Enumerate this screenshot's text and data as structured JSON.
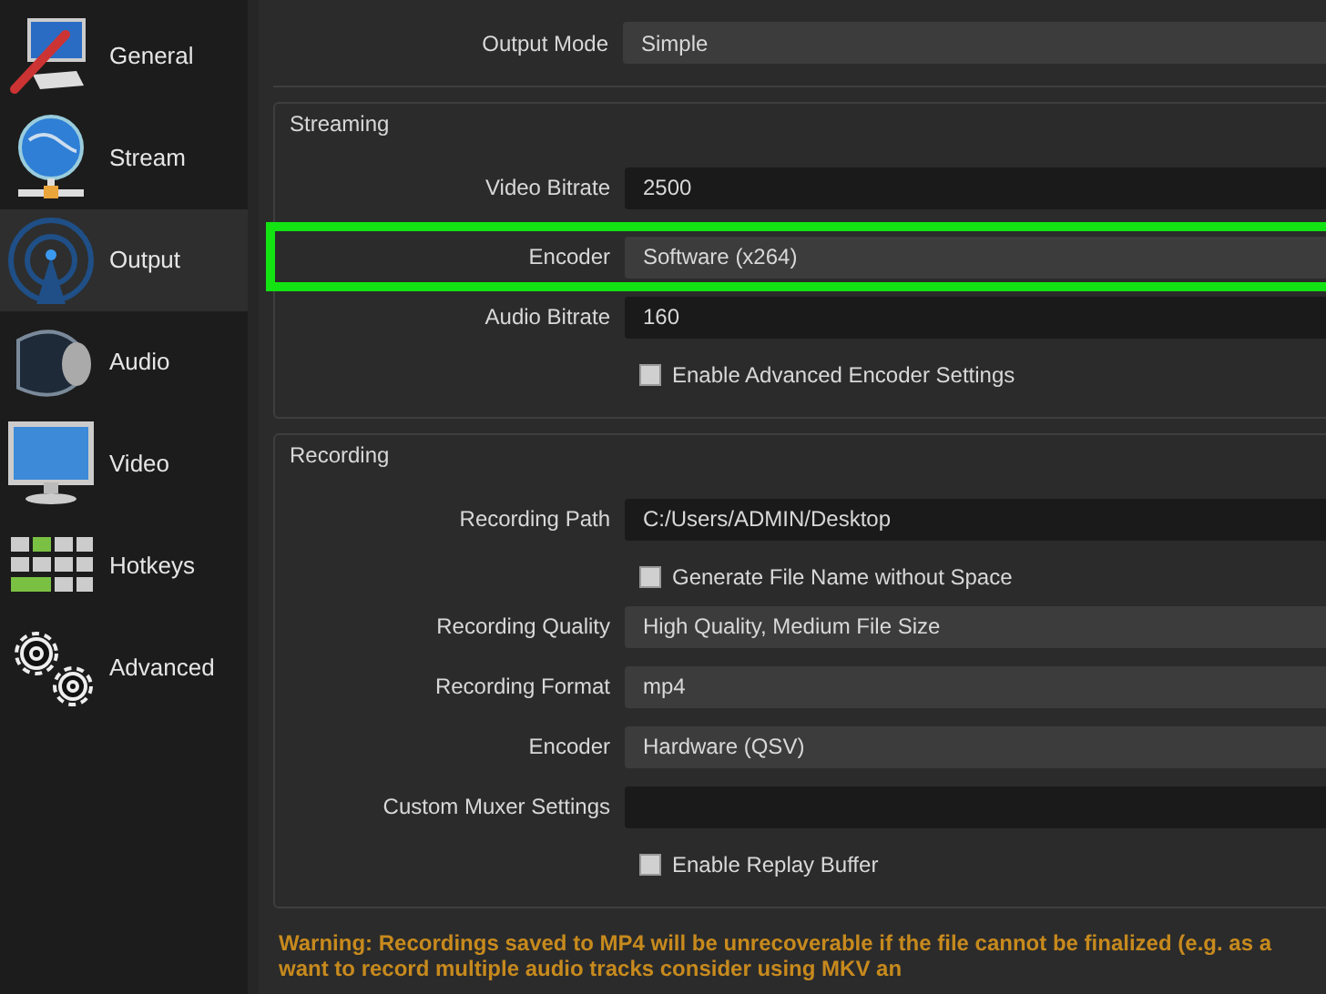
{
  "sidebar": {
    "items": [
      {
        "label": "General",
        "selected": false
      },
      {
        "label": "Stream",
        "selected": false
      },
      {
        "label": "Output",
        "selected": true
      },
      {
        "label": "Audio",
        "selected": false
      },
      {
        "label": "Video",
        "selected": false
      },
      {
        "label": "Hotkeys",
        "selected": false
      },
      {
        "label": "Advanced",
        "selected": false
      }
    ]
  },
  "output_mode": {
    "label": "Output Mode",
    "value": "Simple"
  },
  "groups": [
    {
      "title": "Streaming",
      "rows": [
        {
          "kind": "input",
          "label": "Video Bitrate",
          "value": "2500",
          "highlighted": false
        },
        {
          "kind": "select",
          "label": "Encoder",
          "value": "Software (x264)",
          "highlighted": true
        },
        {
          "kind": "input",
          "label": "Audio Bitrate",
          "value": "160",
          "highlighted": false
        },
        {
          "kind": "checkbox",
          "label": "Enable Advanced Encoder Settings",
          "checked": false
        }
      ]
    },
    {
      "title": "Recording",
      "rows": [
        {
          "kind": "input",
          "label": "Recording Path",
          "value": "C:/Users/ADMIN/Desktop",
          "highlighted": false
        },
        {
          "kind": "checkbox",
          "label": "Generate File Name without Space",
          "checked": false
        },
        {
          "kind": "select",
          "label": "Recording Quality",
          "value": "High Quality, Medium File Size",
          "highlighted": false
        },
        {
          "kind": "select",
          "label": "Recording Format",
          "value": "mp4",
          "highlighted": false
        },
        {
          "kind": "select",
          "label": "Encoder",
          "value": "Hardware (QSV)",
          "highlighted": false
        },
        {
          "kind": "input",
          "label": "Custom Muxer Settings",
          "value": "",
          "highlighted": false
        },
        {
          "kind": "checkbox",
          "label": "Enable Replay Buffer",
          "checked": false
        }
      ]
    }
  ],
  "warning": [
    "Warning: Recordings saved to MP4 will be unrecoverable if the file cannot be finalized (e.g. as a",
    "want to record multiple audio tracks consider using MKV an"
  ]
}
